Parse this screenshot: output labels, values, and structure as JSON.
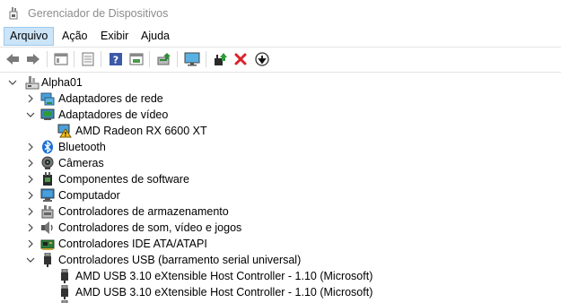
{
  "window": {
    "title": "Gerenciador de Dispositivos"
  },
  "menu": [
    "Arquivo",
    "Ação",
    "Exibir",
    "Ajuda"
  ],
  "toolbar": {
    "buttons": [
      "back-icon",
      "forward-icon",
      "properties-grid-icon",
      "document-icon",
      "help-icon",
      "view-icon",
      "scan-hardware-icon",
      "monitor-icon",
      "update-driver-icon",
      "uninstall-x-icon",
      "disable-down-icon"
    ]
  },
  "tree": {
    "root": "Alpha01",
    "items": [
      {
        "label": "Adaptadores de rede",
        "icon": "network-adapter-icon",
        "expanded": false
      },
      {
        "label": "Adaptadores de vídeo",
        "icon": "display-adapter-icon",
        "expanded": true,
        "children": [
          {
            "label": "AMD Radeon RX 6600 XT",
            "icon": "warning-icon"
          }
        ]
      },
      {
        "label": "Bluetooth",
        "icon": "bluetooth-icon",
        "expanded": false
      },
      {
        "label": "Câmeras",
        "icon": "camera-icon",
        "expanded": false
      },
      {
        "label": "Componentes de software",
        "icon": "software-component-icon",
        "expanded": false
      },
      {
        "label": "Computador",
        "icon": "computer-icon",
        "expanded": false
      },
      {
        "label": "Controladores de armazenamento",
        "icon": "storage-controller-icon",
        "expanded": false
      },
      {
        "label": "Controladores de som, vídeo e jogos",
        "icon": "sound-icon",
        "expanded": false
      },
      {
        "label": "Controladores IDE ATA/ATAPI",
        "icon": "ide-controller-icon",
        "expanded": false
      },
      {
        "label": "Controladores USB (barramento serial universal)",
        "icon": "usb-icon",
        "expanded": true,
        "children": [
          {
            "label": "AMD USB 3.10 eXtensible Host Controller - 1.10 (Microsoft)",
            "icon": "usb-plug-icon"
          },
          {
            "label": "AMD USB 3.10 eXtensible Host Controller - 1.10 (Microsoft)",
            "icon": "usb-plug-icon"
          }
        ]
      }
    ]
  }
}
